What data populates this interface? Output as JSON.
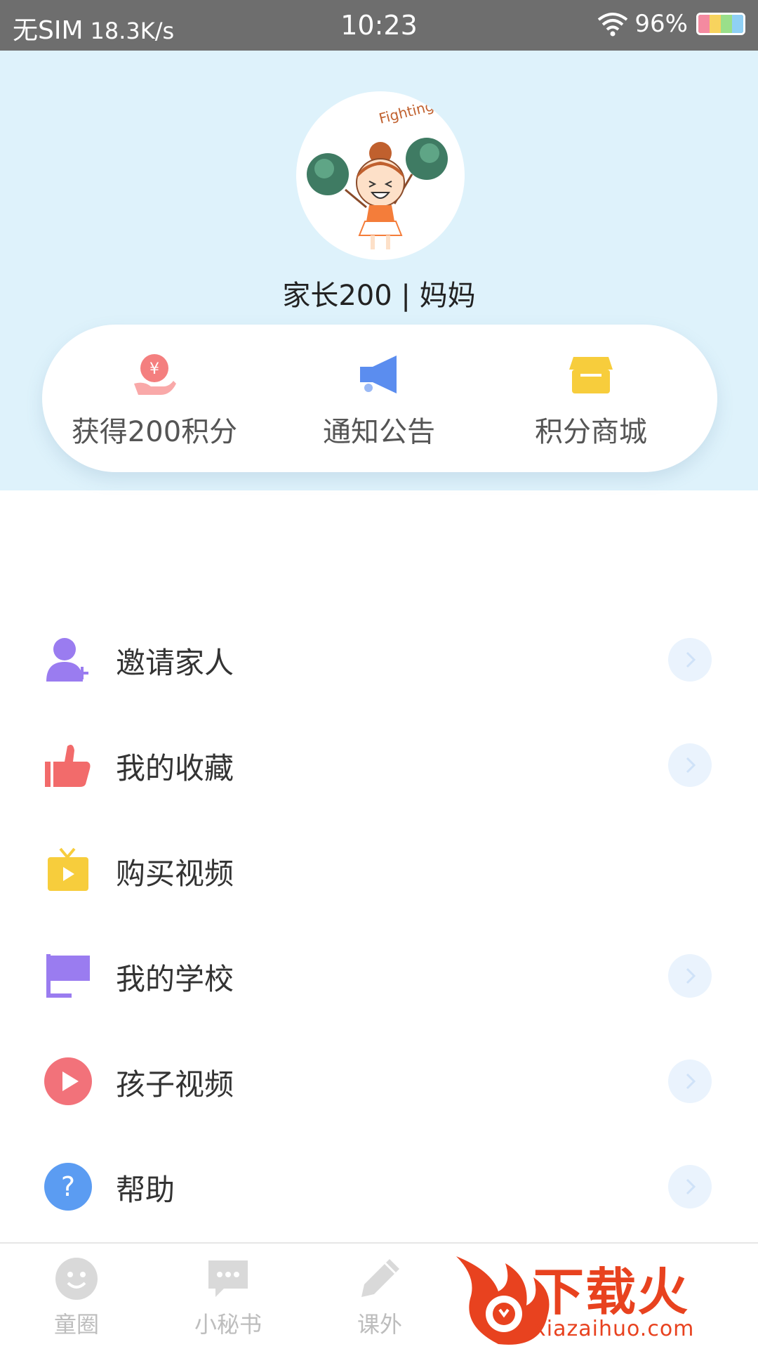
{
  "status_bar": {
    "carrier": "无SIM",
    "speed": "18.3K/s",
    "time": "10:23",
    "battery": "96%"
  },
  "profile": {
    "avatar": "cheerleader-girl-avatar",
    "avatar_text": "Fighting",
    "name": "家长200 | 妈妈"
  },
  "quick_actions": [
    {
      "label": "获得200积分",
      "icon": "points-hand-icon",
      "color": "#f47f7f"
    },
    {
      "label": "通知公告",
      "icon": "megaphone-icon",
      "color": "#5b8def"
    },
    {
      "label": "积分商城",
      "icon": "store-icon",
      "color": "#f7cd3c"
    }
  ],
  "menu": [
    {
      "label": "邀请家人",
      "icon": "invite-user-icon",
      "color": "#9a7cf0",
      "arrow": true
    },
    {
      "label": "我的收藏",
      "icon": "thumbs-up-icon",
      "color": "#f26b6b",
      "arrow": true
    },
    {
      "label": "购买视频",
      "icon": "tv-icon",
      "color": "#f7cd3c",
      "arrow": false
    },
    {
      "label": "我的学校",
      "icon": "flag-icon",
      "color": "#9a7cf0",
      "arrow": true
    },
    {
      "label": "孩子视频",
      "icon": "play-icon",
      "color": "#f2727a",
      "arrow": true
    },
    {
      "label": "帮助",
      "icon": "help-icon",
      "color": "#5b9cf2",
      "arrow": true
    }
  ],
  "bottom_nav": [
    {
      "label": "童圈",
      "icon": "smile-icon"
    },
    {
      "label": "小秘书",
      "icon": "chat-icon"
    },
    {
      "label": "课外",
      "icon": "pencil-icon"
    }
  ],
  "watermark": {
    "text": "下载火",
    "url": "xiazaihuo.com"
  },
  "colors": {
    "header_bg": "#def2fb",
    "status_bar_bg": "#6e6e6e",
    "accent_red": "#e8421f"
  }
}
